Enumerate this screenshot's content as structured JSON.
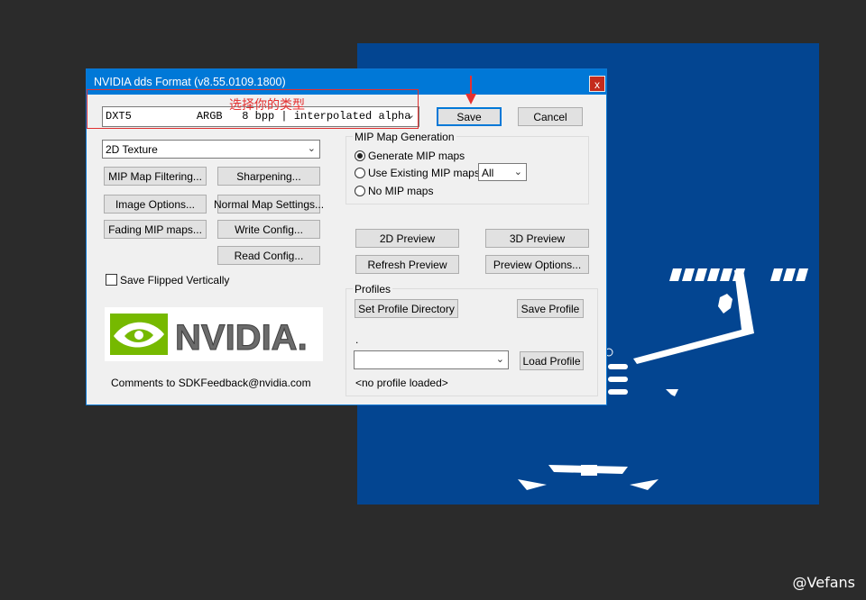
{
  "dialog": {
    "title": "NVIDIA dds Format (v8.55.0109.1800)",
    "close_glyph": "x"
  },
  "format_select": {
    "value": "DXT5          ARGB   8 bpp | interpolated alpha"
  },
  "texture_select": {
    "value": "2D Texture"
  },
  "buttons": {
    "save": "Save",
    "cancel": "Cancel",
    "mip_filtering": "MIP Map Filtering...",
    "sharpening": "Sharpening...",
    "image_options": "Image Options...",
    "normal_map": "Normal Map Settings...",
    "fading_mip": "Fading MIP maps...",
    "write_config": "Write Config...",
    "read_config": "Read Config...",
    "preview_2d": "2D Preview",
    "preview_3d": "3D Preview",
    "refresh_preview": "Refresh Preview",
    "preview_options": "Preview Options...",
    "set_profile_dir": "Set Profile Directory",
    "save_profile": "Save Profile",
    "load_profile": "Load Profile"
  },
  "save_flipped": {
    "label": "Save Flipped Vertically",
    "checked": false
  },
  "mip_group": {
    "title": "MIP Map Generation",
    "options": [
      "Generate MIP maps",
      "Use Existing MIP maps",
      "No MIP maps"
    ],
    "selected_index": 0,
    "count_select": "All"
  },
  "profiles": {
    "title": "Profiles",
    "path": ".",
    "status": "<no profile loaded>"
  },
  "logo": {
    "text": "NVIDIA.",
    "icon": "nvidia-eye-icon"
  },
  "comments": "Comments to SDKFeedback@nvidia.com",
  "annotation": {
    "text": "选择你的类型",
    "color": "#e53030"
  },
  "watermark": "@Vefans",
  "colors": {
    "titlebar": "#0078d7",
    "canvas": "#034591",
    "background": "#2b2b2b",
    "nvidia_green": "#76b900"
  }
}
